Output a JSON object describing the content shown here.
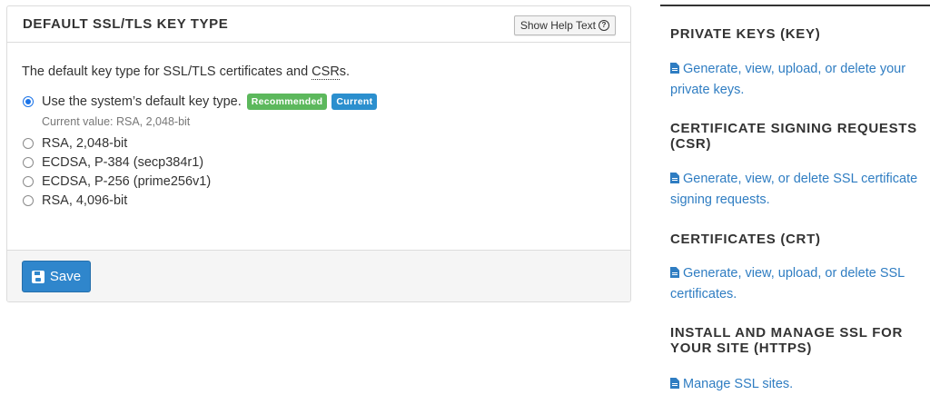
{
  "panel": {
    "title": "DEFAULT SSL/TLS KEY TYPE",
    "help_button": "Show Help Text",
    "help_icon": "question-circle-icon",
    "intro_prefix": "The default key type for SSL/TLS certificates and ",
    "intro_abbr": "CSR",
    "intro_suffix": "s.",
    "options": [
      {
        "label": "Use the system’s default key type.",
        "checked": true
      },
      {
        "label": "RSA, 2,048-bit",
        "checked": false
      },
      {
        "label": "ECDSA, P-384 (secp384r1)",
        "checked": false
      },
      {
        "label": "ECDSA, P-256 (prime256v1)",
        "checked": false
      },
      {
        "label": "RSA, 4,096-bit",
        "checked": false
      }
    ],
    "badges": {
      "recommended": "Recommended",
      "current": "Current"
    },
    "current_value": "Current value: RSA, 2,048-bit",
    "save_label": "Save",
    "save_icon": "floppy-disk-icon"
  },
  "sidebar": {
    "sections": [
      {
        "heading": "PRIVATE KEYS (KEY)",
        "link": "Generate, view, upload, or delete your private keys."
      },
      {
        "heading": "CERTIFICATE SIGNING REQUESTS (CSR)",
        "link": "Generate, view, or delete SSL certificate signing requests."
      },
      {
        "heading": "CERTIFICATES (CRT)",
        "link": "Generate, view, upload, or delete SSL certificates."
      },
      {
        "heading": "INSTALL AND MANAGE SSL FOR YOUR SITE (HTTPS)",
        "link": "Manage SSL sites."
      }
    ],
    "link_icon": "document-icon"
  },
  "colors": {
    "accent": "#2f86cc",
    "link": "#2f7dc2",
    "badge_recommended": "#5cb85c",
    "badge_current": "#2b8fce"
  }
}
